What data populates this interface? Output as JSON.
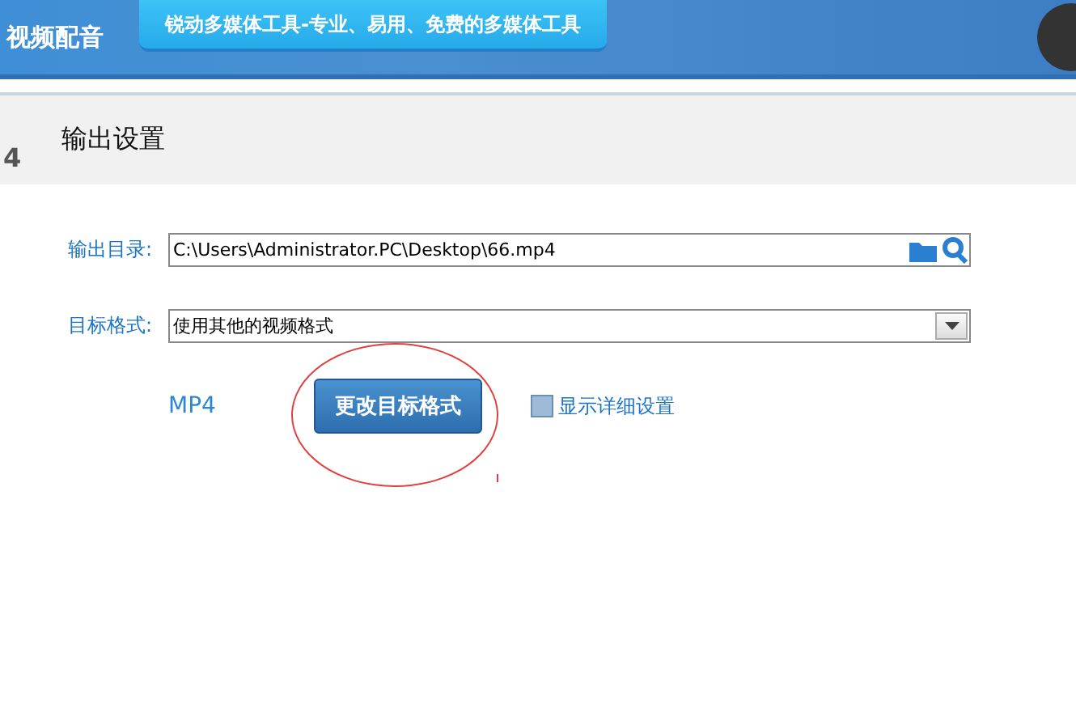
{
  "app_title": "视频配音",
  "tagline": "锐动多媒体工具-专业、易用、免费的多媒体工具",
  "section": {
    "step": "4",
    "title": "输出设置"
  },
  "output_dir": {
    "label": "输出目录:",
    "value": "C:\\Users\\Administrator.PC\\Desktop\\66.mp4"
  },
  "target_format": {
    "label": "目标格式:",
    "value": "使用其他的视频格式"
  },
  "format_name": "MP4",
  "change_button": "更改目标格式",
  "details_checkbox": {
    "label": "显示详细设置",
    "checked": false
  }
}
